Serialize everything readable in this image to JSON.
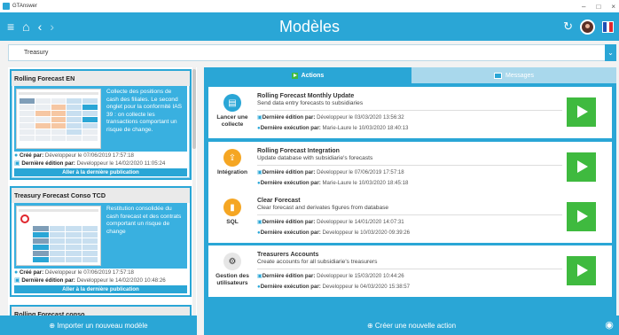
{
  "window": {
    "title": "GTAnswer",
    "controls": [
      "–",
      "□",
      "×"
    ]
  },
  "header": {
    "title": "Modèles",
    "menu_icon": "menu-icon",
    "home_icon": "home-icon",
    "back_icon": "chevron-left-icon",
    "forward_icon": "chevron-right-icon",
    "refresh_icon": "refresh-icon"
  },
  "selector": {
    "value": "Treasury"
  },
  "models": [
    {
      "title": "Rolling Forecast EN",
      "description": "Collecte des positions de cash des filiales. Le second onglet pour la conformité IAS 39 : on collecte les transactions comportant un risque de change.",
      "created_label": "Créé par:",
      "created_value": "Développeur le 07/06/2019 17:57:18",
      "edited_label": "Dernière édition par:",
      "edited_value": "Developpeur le 14/02/2020 11:05:24",
      "button": "Aller à la dernière publication"
    },
    {
      "title": "Treasury Forecast Conso TCD",
      "description": "Restitution consolidée du cash forecast et des contrats comportant un risque de change",
      "created_label": "Créé par:",
      "created_value": "Développeur le 07/06/2019 17:57:18",
      "edited_label": "Dernière édition par:",
      "edited_value": "Developpeur le 14/02/2020 10:48:26",
      "button": "Aller à la dernière publication"
    },
    {
      "title": "Rolling Forecast conso"
    }
  ],
  "tabs": {
    "actions": "Actions",
    "messages": "Messages"
  },
  "actions": [
    {
      "category": "Lancer une collecte",
      "icon": "database-icon",
      "name": "Rolling Forecast Monthly Update",
      "description": "Send data entry forecasts to subsidiaries",
      "edited_label": "Dernière édition par:",
      "edited_value": "Développeur le 03/03/2020 13:56:32",
      "executed_label": "Dernière exécution par:",
      "executed_value": "Marie-Laure le 10/03/2020 18:40:13"
    },
    {
      "category": "Intégration",
      "icon": "upload-icon",
      "name": "Rolling Forecast Integration",
      "description": "Update database with subsidiarie's forecasts",
      "edited_label": "Dernière édition par:",
      "edited_value": "Développeur le 07/06/2019 17:57:18",
      "executed_label": "Dernière exécution par:",
      "executed_value": "Marie-Laure le 10/03/2020 18:45:18"
    },
    {
      "category": "SQL",
      "icon": "sql-icon",
      "name": "Clear Forecast",
      "description": "Clear forecast and derivates figures from database",
      "edited_label": "Dernière édition par:",
      "edited_value": "Développeur le 14/01/2020 14:07:31",
      "executed_label": "Dernière exécution par:",
      "executed_value": "Developpeur le 10/03/2020 09:39:26"
    },
    {
      "category": "Gestion des utilisateurs",
      "icon": "users-icon",
      "name": "Treasurers Accounts",
      "description": "Create accounts for all subsidiarie's treasurers",
      "edited_label": "Dernière édition par:",
      "edited_value": "Développeur le 15/03/2020 10:44:26",
      "executed_label": "Dernière exécution par:",
      "executed_value": "Developpeur le 04/03/2020 15:38:57"
    }
  ],
  "footer": {
    "import_model": "Importer un nouveau modèle",
    "create_action": "Créer une nouvelle action"
  },
  "colors": {
    "accent": "#2aa6d6",
    "play": "#3fba3f",
    "orange": "#f5a623"
  }
}
